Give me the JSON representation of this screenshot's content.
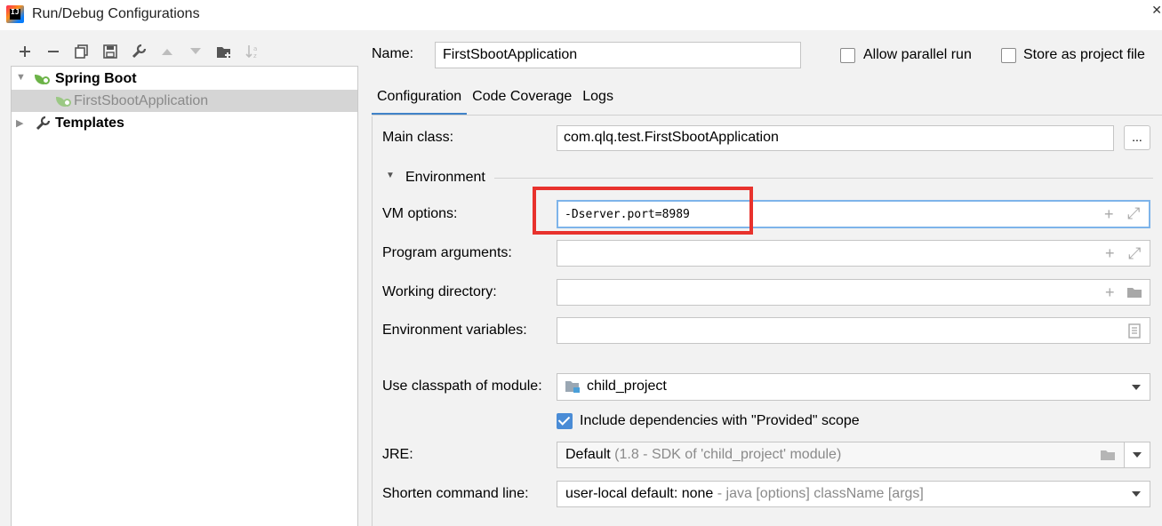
{
  "window": {
    "title": "Run/Debug Configurations"
  },
  "toolbar": {
    "icons": [
      "add-icon",
      "remove-icon",
      "copy-icon",
      "save-icon",
      "wrench-icon",
      "move-up-icon",
      "move-down-icon",
      "new-folder-icon",
      "sort-icon"
    ]
  },
  "tree": {
    "group": "Spring Boot",
    "child": "FirstSbootApplication",
    "templates": "Templates"
  },
  "header": {
    "name_label": "Name:",
    "name_value": "FirstSbootApplication",
    "allow_parallel_label": "Allow parallel run",
    "store_as_file_label": "Store as project file"
  },
  "tabs": [
    {
      "label": "Configuration",
      "active": true
    },
    {
      "label": "Code Coverage",
      "active": false
    },
    {
      "label": "Logs",
      "active": false
    }
  ],
  "form": {
    "main_class_label": "Main class:",
    "main_class_value": "com.qlq.test.FirstSbootApplication",
    "browse_label": "...",
    "environment_label": "Environment",
    "vm_options_label": "VM options:",
    "vm_options_value": "-Dserver.port=8989",
    "program_args_label": "Program arguments:",
    "working_dir_label": "Working directory:",
    "env_vars_label": "Environment variables:",
    "classpath_label": "Use classpath of module:",
    "classpath_value": "child_project",
    "include_deps_label": "Include dependencies with \"Provided\" scope",
    "include_deps_checked": true,
    "jre_label": "JRE:",
    "jre_value": "Default",
    "jre_detail": "(1.8 - SDK of 'child_project' module)",
    "shorten_label": "Shorten command line:",
    "shorten_value": "user-local default: none",
    "shorten_detail": "- java [options] className [args]"
  },
  "colors": {
    "highlight": "#e8322d",
    "tab_accent": "#4083c9",
    "checkbox": "#4a8cd6",
    "spring": "#6cb348"
  }
}
